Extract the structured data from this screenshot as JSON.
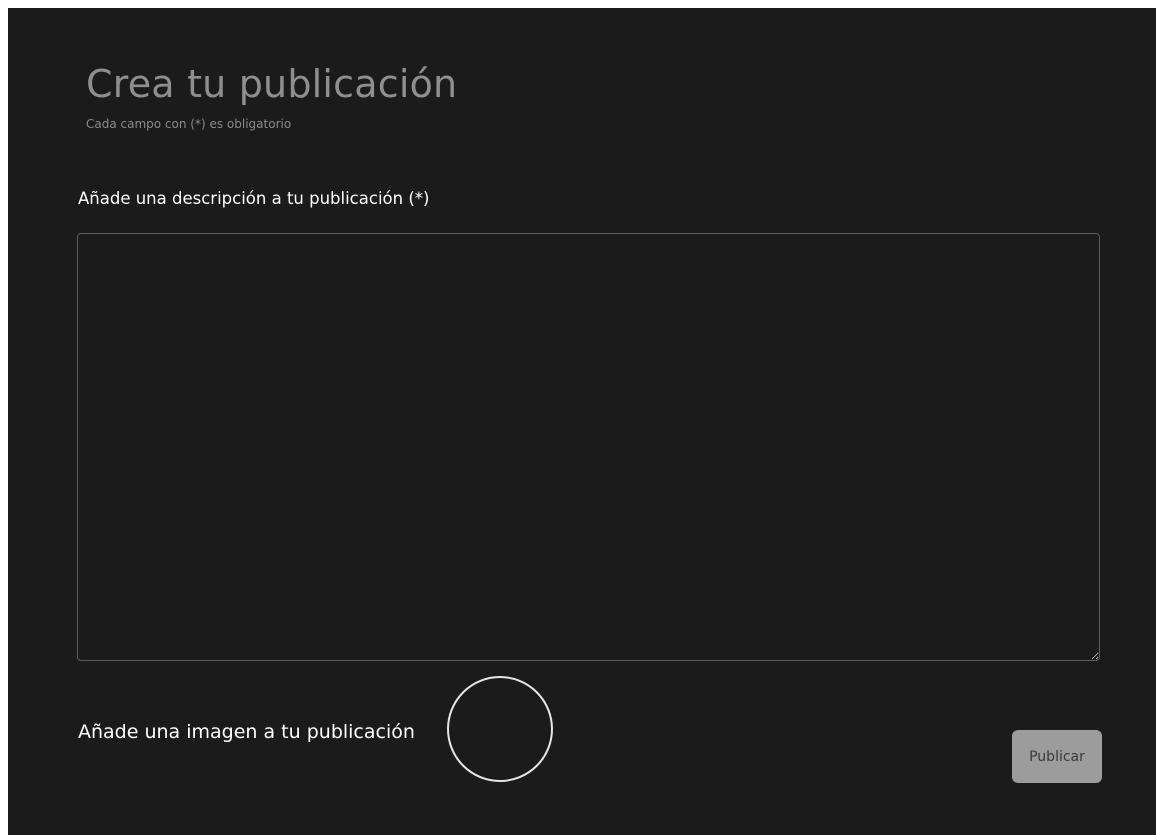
{
  "form": {
    "title": "Crea tu publicación",
    "subtitle": "Cada campo con (*) es obligatorio",
    "description": {
      "label": "Añade una descripción a tu publicación (*)",
      "value": "",
      "placeholder": ""
    },
    "image": {
      "label": "Añade una imagen a tu publicación"
    },
    "publish_label": "Publicar"
  },
  "colors": {
    "panel_background": "#1b1b1b",
    "title_text": "#8f8f8f",
    "label_text": "#ffffff",
    "publish_button_background": "#9c9c9c"
  }
}
